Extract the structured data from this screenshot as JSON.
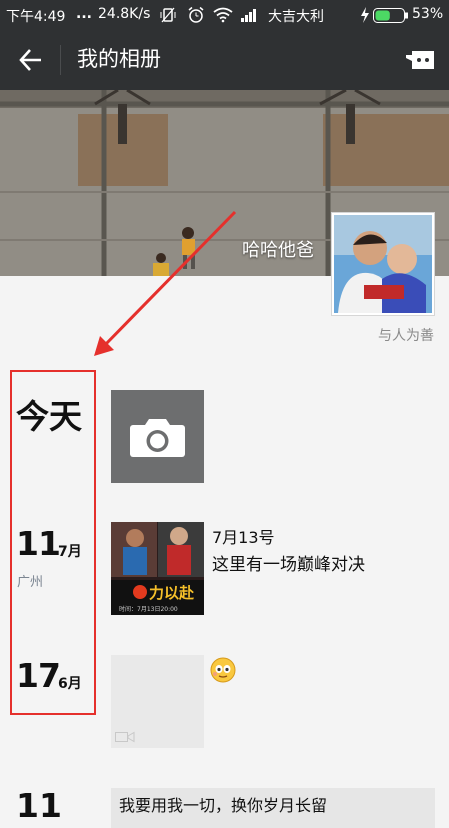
{
  "status_bar": {
    "time": "下午4:49",
    "dots": "...",
    "net_speed": "24.8K/s",
    "carrier": "大吉大利",
    "battery": "53%",
    "battery_level": 0.53
  },
  "header": {
    "title": "我的相册"
  },
  "profile": {
    "name": "哈哈他爸",
    "signature": "与人为善"
  },
  "timeline": {
    "today_label": "今天",
    "entries": [
      {
        "day": "11",
        "month": "7月",
        "location": "广州",
        "post_date": "7月13号",
        "post_text": "这里有一场巅峰对决"
      },
      {
        "day": "17",
        "month": "6月"
      },
      {
        "day": "11",
        "post_text": "我要用我一切，换你岁月长留"
      }
    ]
  },
  "thumb_text": {
    "slogan": "力以赴",
    "caption": "时间：7月13日20:00"
  },
  "colors": {
    "bar": "#2f3133",
    "annotation_red": "#e5302c",
    "battery_green": "#4cd964"
  }
}
